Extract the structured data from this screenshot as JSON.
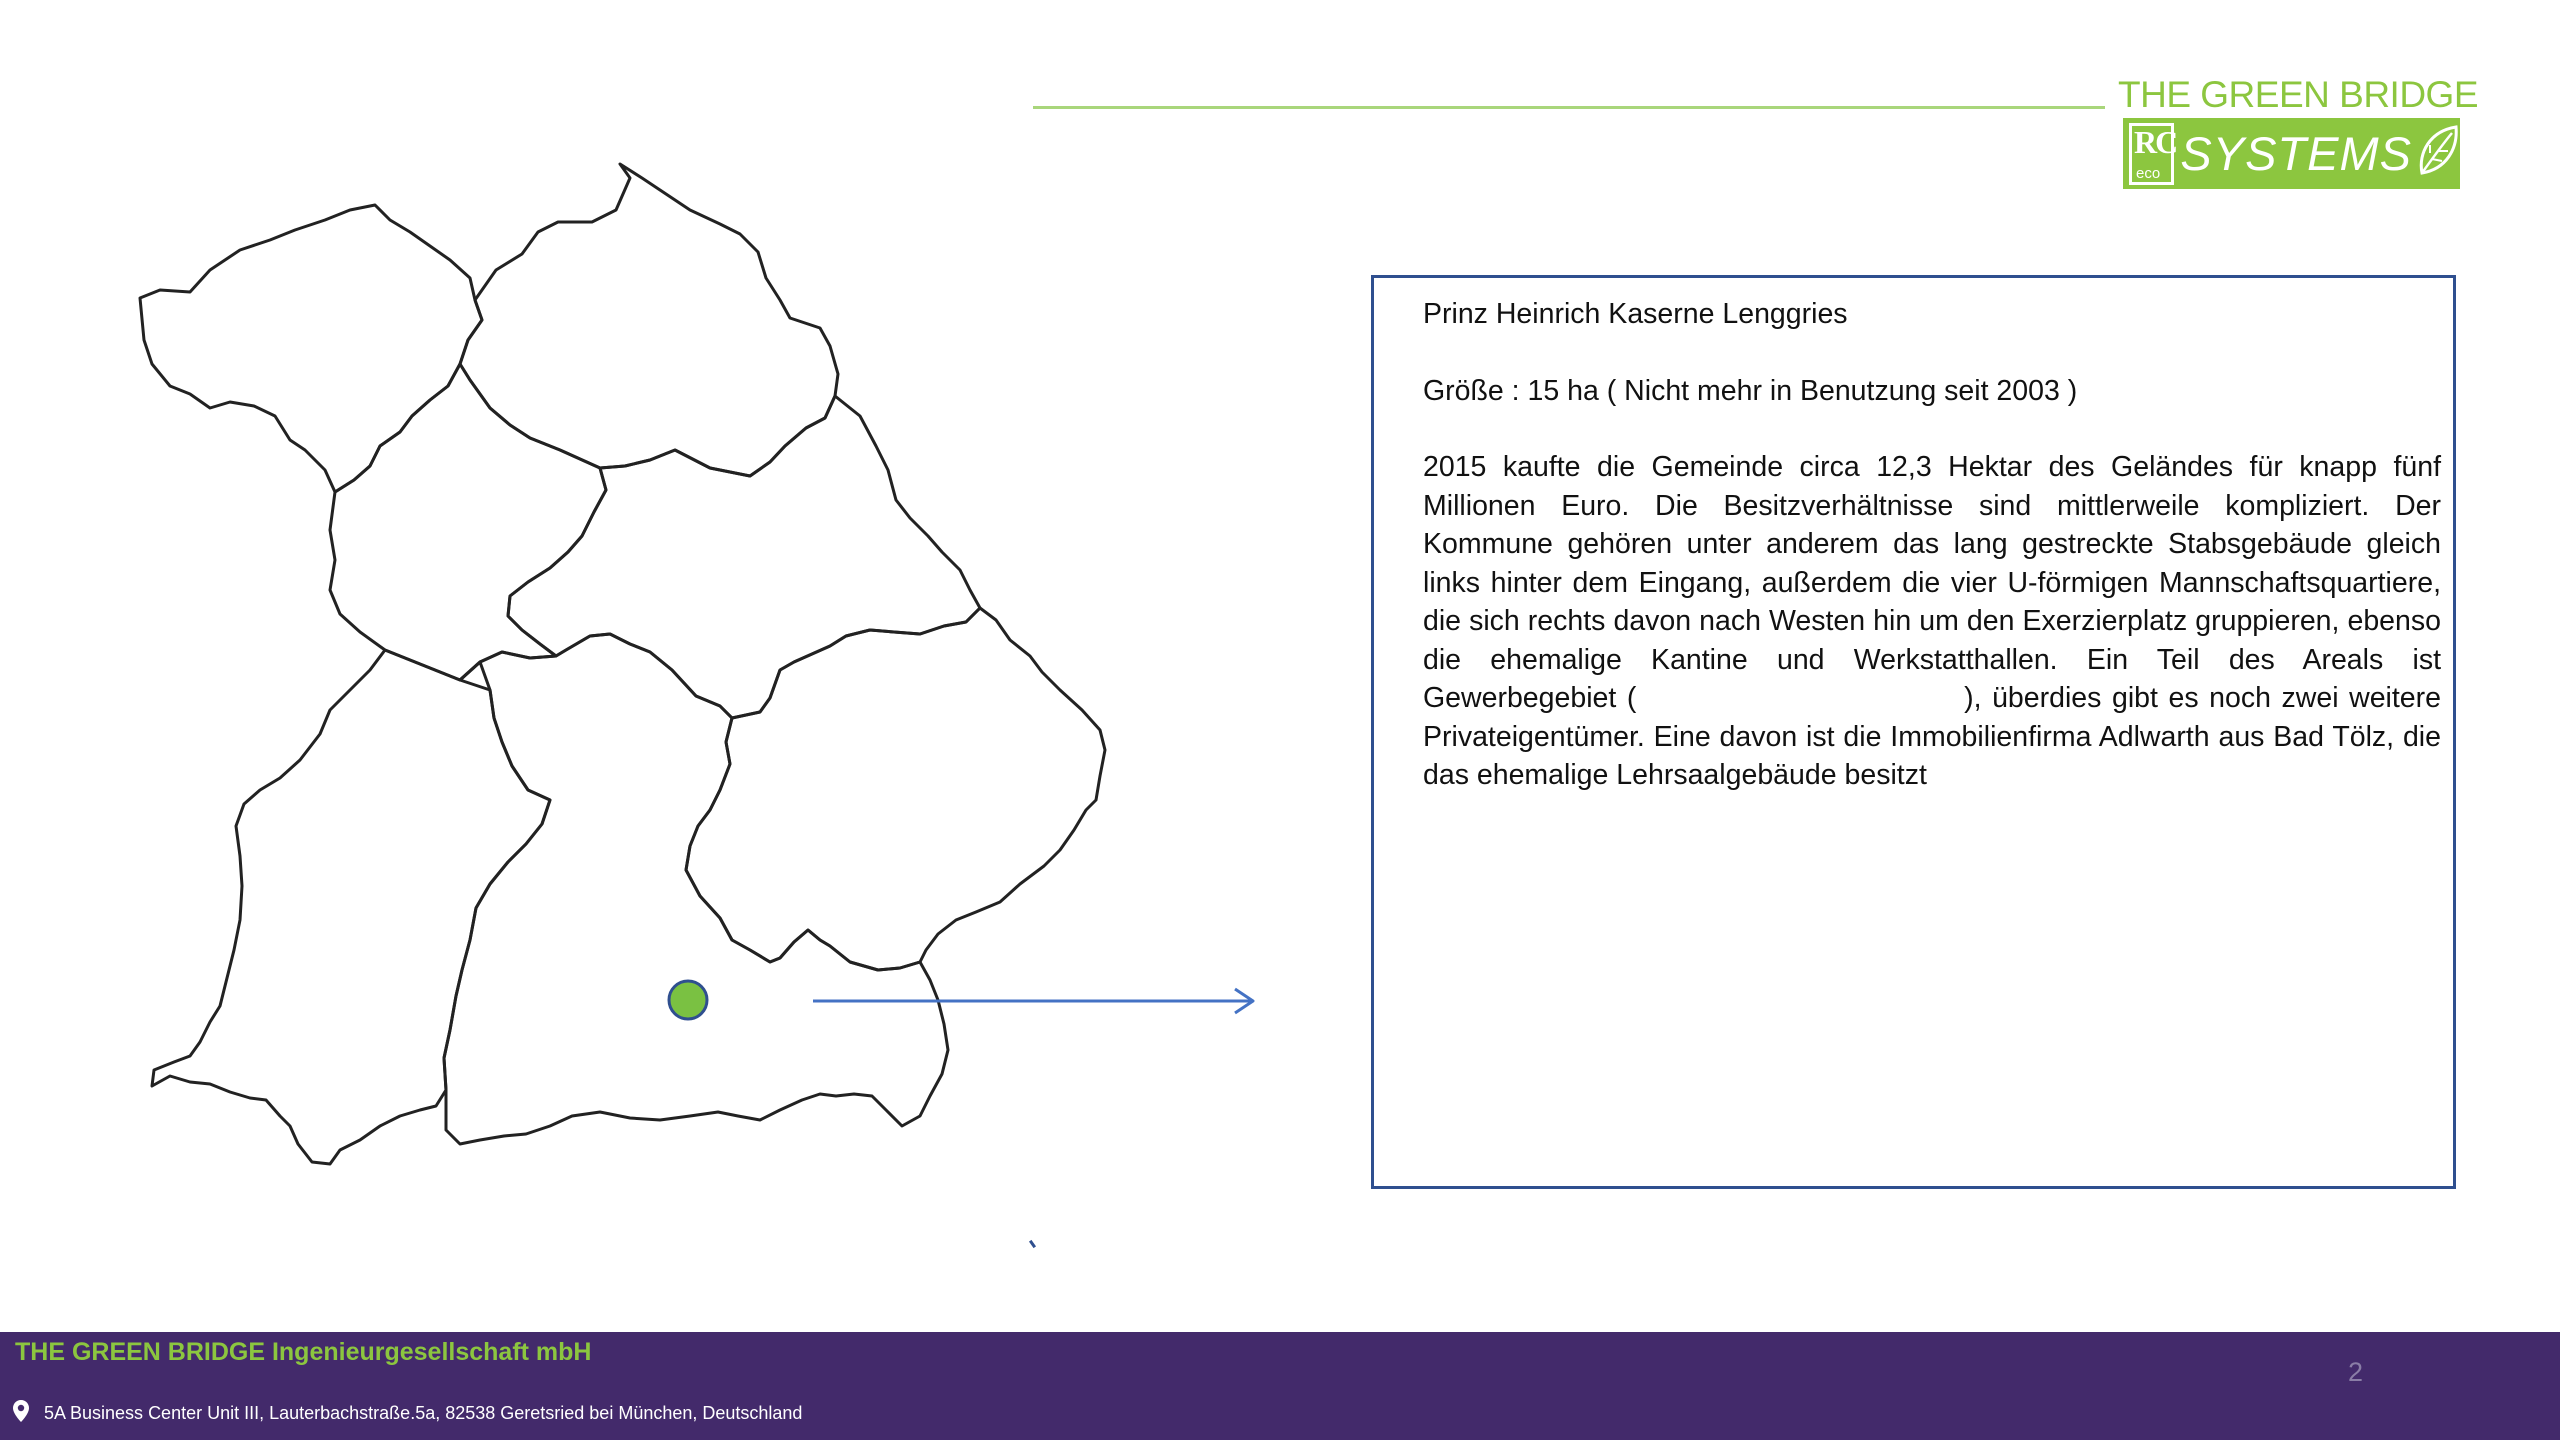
{
  "header": {
    "brand_title": "THE GREEN BRIDGE",
    "logo_rc": "RC",
    "logo_eco": "eco",
    "logo_systems": "SYSTEMS",
    "brand_color": "#8cc63f",
    "logo_icon": "leaf-icon"
  },
  "map": {
    "marker_color": "#7ac142",
    "arrow_color": "#4472c4",
    "icon": "location-marker-icon"
  },
  "info": {
    "title": "Prinz Heinrich Kaserne Lenggries",
    "size": "Größe : 15 ha ( Nicht mehr in Benutzung seit 2003 )",
    "body": "2015 kaufte die Gemeinde circa 12,3 Hektar des Geländes für knapp fünf Millionen Euro. Die Besitzverhältnisse sind mittlerweile kompliziert. Der Kommune gehören unter anderem das lang gestreckte Stabsgebäude gleich links hinter dem Eingang, außerdem die vier U-förmigen Mannschaftsquartiere, die sich rechts davon nach Westen hin um den Exerzierplatz gruppieren, ebenso die ehemalige Kantine und Werkstatthallen. Ein Teil des Areals ist Gewerbegebiet (                               ), überdies gibt es noch zwei weitere Privateigentümer. Eine davon ist die Immobilienfirma Adlwarth aus Bad Tölz, die das ehemalige Lehrsaalgebäude besitzt",
    "border_color": "#2f4f8f"
  },
  "footer": {
    "company": "THE GREEN BRIDGE Ingenieurgesellschaft mbH",
    "address": "5A Business Center Unit III, Lauterbachstraße.5a, 82538 Geretsried bei München, Deutschland",
    "address_icon": "map-pin-icon",
    "page_number": "2",
    "background": "#432a6b"
  }
}
